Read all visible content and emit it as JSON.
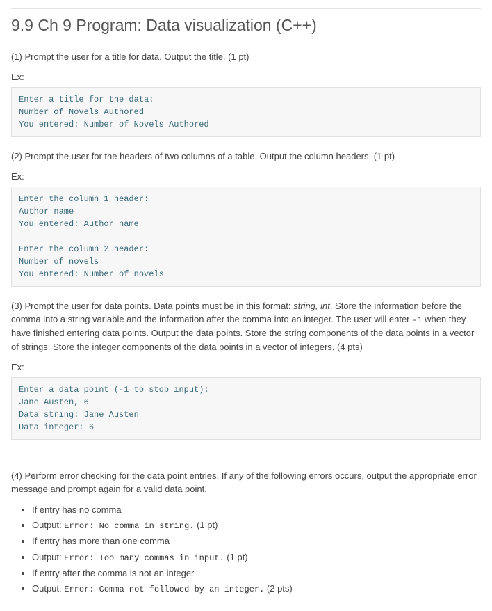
{
  "title": "9.9 Ch 9 Program: Data visualization (C++)",
  "p1": "(1) Prompt the user for a title for data. Output the title. (1 pt)",
  "exLabel": "Ex:",
  "code1": "Enter a title for the data:\nNumber of Novels Authored\nYou entered: Number of Novels Authored",
  "p2": "(2) Prompt the user for the headers of two columns of a table. Output the column headers. (1 pt)",
  "code2": "Enter the column 1 header:\nAuthor name\nYou entered: Author name\n\nEnter the column 2 header:\nNumber of novels\nYou entered: Number of novels",
  "p3_a": "(3) Prompt the user for data points. Data points must be in this format: ",
  "p3_fmt": "string, int",
  "p3_b": ". Store the information before the comma into a string variable and the information after the comma into an integer. The user will enter ",
  "p3_neg1": "-1",
  "p3_c": " when they have finished entering data points. Output the data points. Store the string components of the data points in a vector of strings. Store the integer components of the data points in a vector of integers. (4 pts)",
  "code3": "Enter a data point (-1 to stop input):\nJane Austen, 6\nData string: Jane Austen\nData integer: 6",
  "p4": "(4) Perform error checking for the data point entries. If any of the following errors occurs, output the appropriate error message and prompt again for a valid data point.",
  "li1": "If entry has no comma",
  "li2a": "Output: ",
  "li2b": "Error: No comma in string.",
  "li2c": " (1 pt)",
  "li3": "If entry has more than one comma",
  "li4b": "Error: Too many commas in input.",
  "li4c": " (1 pt)",
  "li5": "If entry after the comma is not an integer",
  "li6b": "Error: Comma not followed by an integer.",
  "li6c": " (2 pts)"
}
